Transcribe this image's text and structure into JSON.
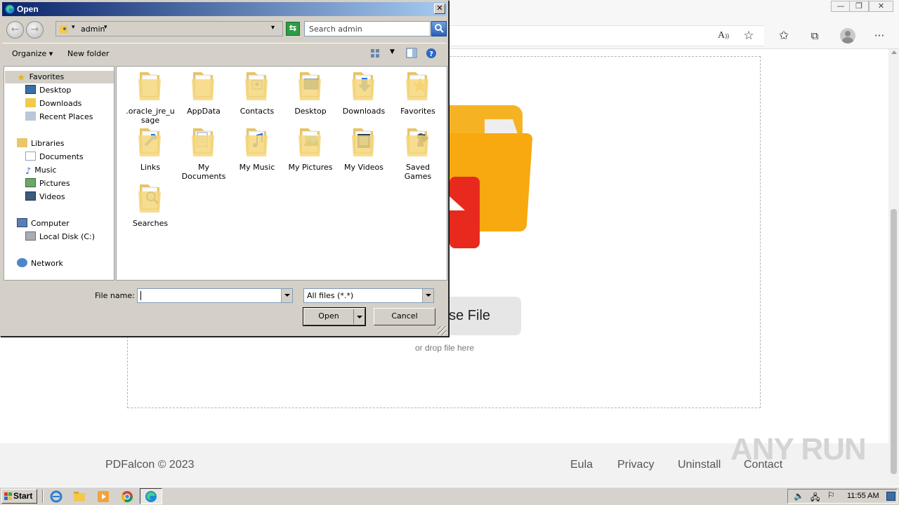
{
  "browser": {
    "window_controls": [
      "—",
      "❐",
      "✕"
    ],
    "toolbar_icons": [
      "read-aloud-icon",
      "add-favorite-icon",
      "favorites-icon",
      "collections-icon",
      "profile-icon",
      "more-icon"
    ],
    "more_glyph": "···"
  },
  "page": {
    "choose_button": "ose File",
    "drop_hint": "or drop file here",
    "footer": {
      "copyright": "PDFalcon © 2023",
      "links": [
        "Eula",
        "Privacy",
        "Uninstall",
        "Contact"
      ]
    },
    "watermark": "ANY RUN"
  },
  "dialog": {
    "title": "Open",
    "close": "✕",
    "path": "admin",
    "search_placeholder": "Search admin",
    "commands": {
      "organize": "Organize ▾",
      "new_folder": "New folder"
    },
    "nav": {
      "favorites": "Favorites",
      "favorites_items": [
        "Desktop",
        "Downloads",
        "Recent Places"
      ],
      "libraries": "Libraries",
      "libraries_items": [
        "Documents",
        "Music",
        "Pictures",
        "Videos"
      ],
      "computer": "Computer",
      "computer_items": [
        "Local Disk (C:)"
      ],
      "network": "Network"
    },
    "files": [
      {
        "name": ".oracle_jre_u\nsage",
        "icon": "folder-icon"
      },
      {
        "name": "AppData",
        "icon": "folder-icon"
      },
      {
        "name": "Contacts",
        "icon": "contacts-folder-icon"
      },
      {
        "name": "Desktop",
        "icon": "desktop-folder-icon"
      },
      {
        "name": "Downloads",
        "icon": "downloads-folder-icon"
      },
      {
        "name": "Favorites",
        "icon": "favorites-folder-icon"
      },
      {
        "name": "Links",
        "icon": "links-folder-icon"
      },
      {
        "name": "My\nDocuments",
        "icon": "documents-folder-icon"
      },
      {
        "name": "My Music",
        "icon": "music-folder-icon"
      },
      {
        "name": "My Pictures",
        "icon": "pictures-folder-icon"
      },
      {
        "name": "My Videos",
        "icon": "videos-folder-icon"
      },
      {
        "name": "Saved\nGames",
        "icon": "saved-games-folder-icon"
      },
      {
        "name": "Searches",
        "icon": "searches-folder-icon"
      }
    ],
    "filename_label": "File name:",
    "filename_value": "",
    "filter": "All files (*.*)",
    "open_button": "Open",
    "cancel_button": "Cancel"
  },
  "taskbar": {
    "start": "Start",
    "clock": "11:55 AM"
  }
}
